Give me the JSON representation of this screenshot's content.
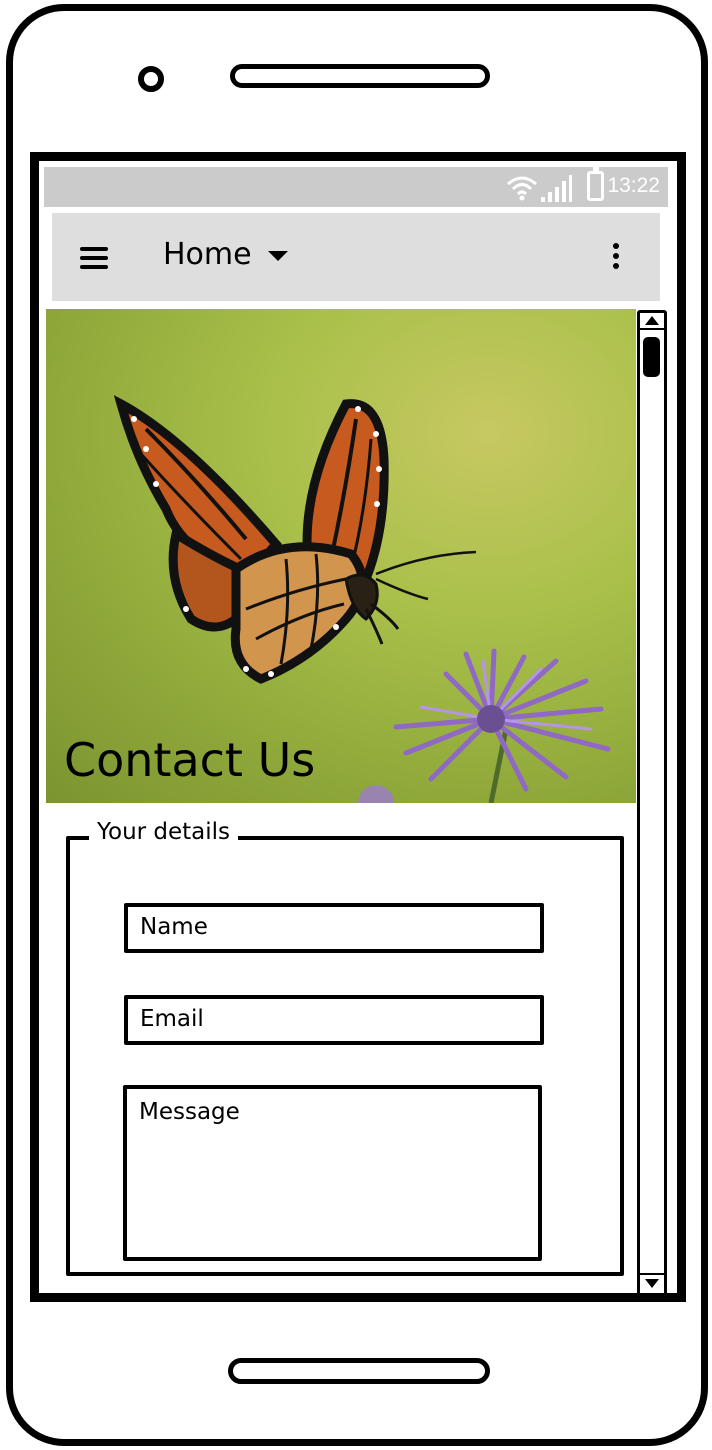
{
  "status_bar": {
    "time": "13:22",
    "icons": [
      "wifi-icon",
      "signal-icon",
      "battery-icon"
    ]
  },
  "app_bar": {
    "title": "Home",
    "left_icon": "menu-icon",
    "title_icon": "dropdown-icon",
    "right_icon": "overflow-menu-icon"
  },
  "hero": {
    "title": "Contact Us",
    "image": "monarch butterfly above a purple aster flower on a green background"
  },
  "form": {
    "legend": "Your details",
    "name_placeholder": "Name",
    "email_placeholder": "Email",
    "message_placeholder": "Message"
  },
  "colors": {
    "status_bar_bg": "#cbcbcb",
    "app_bar_bg": "#dedede",
    "hero_bg": "#a9c04a",
    "outline": "#000000"
  }
}
